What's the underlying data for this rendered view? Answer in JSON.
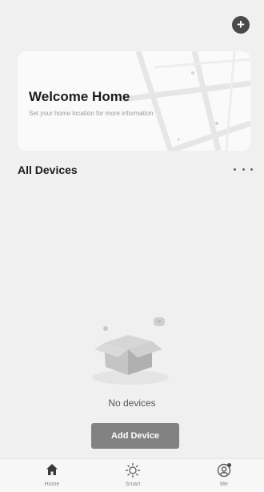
{
  "header": {
    "add_icon": "plus-circle-icon"
  },
  "welcome": {
    "title": "Welcome Home",
    "subtitle": "Set your home location for more information"
  },
  "devices": {
    "title": "All Devices",
    "more_icon": "more-icon",
    "empty_text": "No devices",
    "add_button": "Add Device"
  },
  "tabbar": {
    "items": [
      {
        "label": "Home",
        "icon": "home-icon"
      },
      {
        "label": "Smart",
        "icon": "sun-icon"
      },
      {
        "label": "Me",
        "icon": "user-icon"
      }
    ]
  },
  "colors": {
    "background": "#f0f0f0",
    "card": "#fafafa",
    "button": "#828282",
    "icon_dark": "#4a4a4a"
  }
}
